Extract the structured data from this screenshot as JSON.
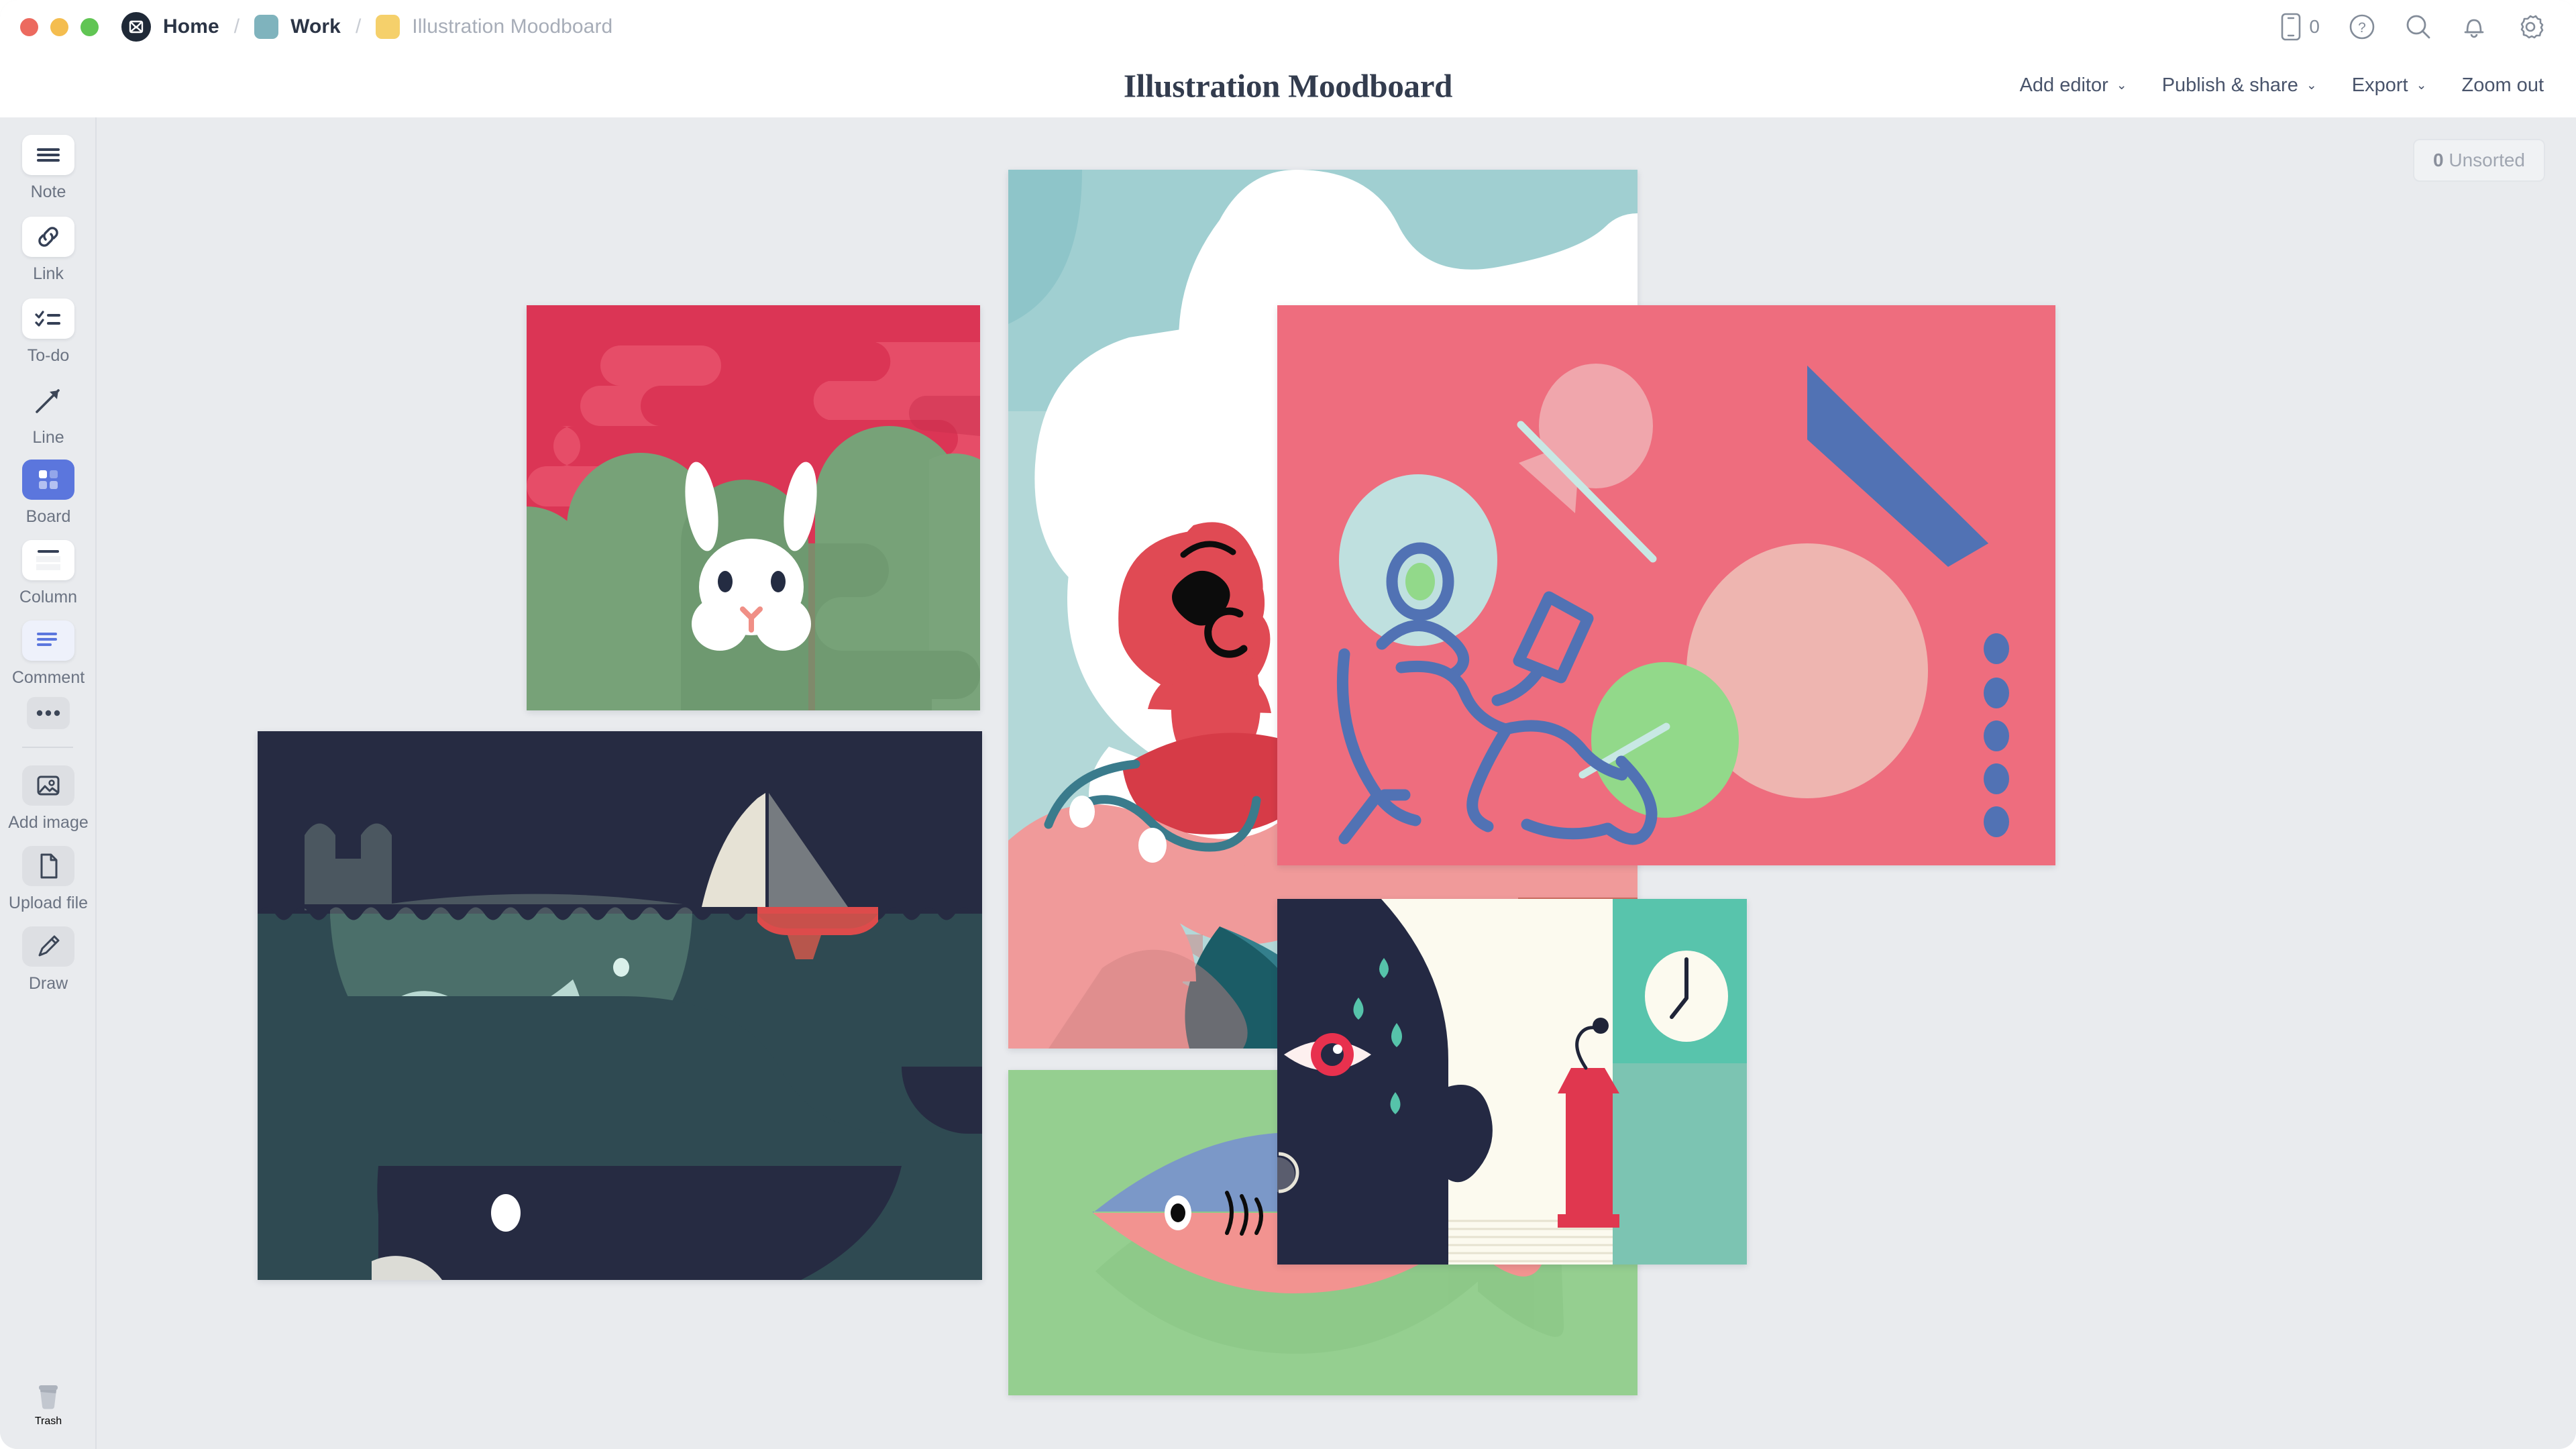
{
  "window": {
    "traffic_lights": [
      "close",
      "minimize",
      "maximize"
    ]
  },
  "breadcrumb": {
    "logo_icon": "milanote-logo-icon",
    "items": [
      {
        "label": "Home",
        "swatch": null,
        "muted": false
      },
      {
        "label": "Work",
        "swatch": "#7fb3bd",
        "muted": false
      },
      {
        "label": "Illustration Moodboard",
        "swatch": "#f5d06b",
        "muted": true
      }
    ],
    "separator": "/"
  },
  "top_right": {
    "device_icon": "mobile-device-icon",
    "device_count": "0",
    "help_icon": "help-circle-icon",
    "search_icon": "search-icon",
    "notifications_icon": "bell-icon",
    "settings_icon": "gear-icon"
  },
  "header": {
    "title": "Illustration Moodboard"
  },
  "toolbar": {
    "items": [
      {
        "label": "Add editor",
        "has_chevron": true,
        "name": "add-editor"
      },
      {
        "label": "Publish & share",
        "has_chevron": true,
        "name": "publish-share"
      },
      {
        "label": "Export",
        "has_chevron": true,
        "name": "export"
      },
      {
        "label": "Zoom out",
        "has_chevron": false,
        "name": "zoom-out"
      }
    ],
    "chevron_glyph": "⌄"
  },
  "sidebar": {
    "tools": [
      {
        "label": "Note",
        "icon": "note-lines-icon",
        "style": "white",
        "name": "note"
      },
      {
        "label": "Link",
        "icon": "link-chain-icon",
        "style": "white",
        "name": "link"
      },
      {
        "label": "To-do",
        "icon": "todo-checklist-icon",
        "style": "white",
        "name": "to-do"
      },
      {
        "label": "Line",
        "icon": "arrow-line-icon",
        "style": "plain",
        "name": "line"
      },
      {
        "label": "Board",
        "icon": "board-grid-icon",
        "style": "blue",
        "name": "board",
        "active": true
      },
      {
        "label": "Column",
        "icon": "column-icon",
        "style": "white",
        "name": "column"
      },
      {
        "label": "Comment",
        "icon": "comment-bubble-icon",
        "style": "lav",
        "name": "comment"
      }
    ],
    "more": {
      "icon": "ellipsis-icon",
      "name": "more-tools"
    },
    "file_tools": [
      {
        "label": "Add image",
        "icon": "image-icon",
        "style": "gray",
        "name": "add-image"
      },
      {
        "label": "Upload file",
        "icon": "file-icon",
        "style": "gray",
        "name": "upload-file"
      },
      {
        "label": "Draw",
        "icon": "pencil-icon",
        "style": "gray",
        "name": "draw"
      }
    ],
    "trash": {
      "label": "Trash",
      "icon": "trash-bin-icon",
      "name": "trash"
    }
  },
  "canvas": {
    "unsorted_count": "0",
    "unsorted_label": "Unsorted",
    "cards": [
      {
        "name": "rabbit-illustration",
        "title": "White rabbit in green bushes with crimson sky"
      },
      {
        "name": "whale-illustration",
        "title": "Whales under dark water with a sailboat above"
      },
      {
        "name": "woman-illustration",
        "title": "Woman with large white hair against pale blue sky"
      },
      {
        "name": "fish-illustration",
        "title": "Blue and pink fish on green background"
      },
      {
        "name": "abstract-illustration",
        "title": "Person reading in a chair among abstract shapes"
      },
      {
        "name": "stage-fright-illustration",
        "title": "Nervous silhouette sweating beside a red podium and clock"
      }
    ]
  },
  "colors": {
    "canvas_bg": "#e9ebee",
    "chrome_bg": "#ffffff",
    "accent_blue": "#5b76dd",
    "text_dark": "#333c4e",
    "text_muted": "#6b7382"
  }
}
